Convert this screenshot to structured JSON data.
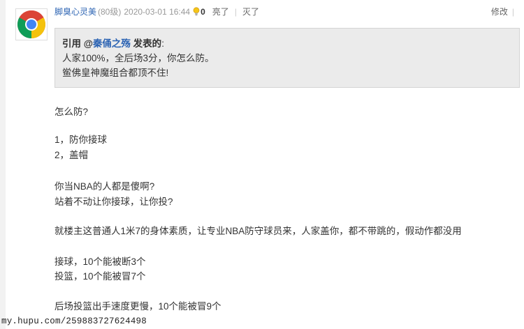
{
  "post": {
    "username": "脚臭心灵美",
    "level": "(80级)",
    "timestamp": "2020-03-01 16:44",
    "light_count": "0",
    "light_action": "亮了",
    "dark_action": "灭了",
    "edit_action": "修改"
  },
  "quote": {
    "prefix": "引用 @",
    "quoted_user": "秦俑之殇",
    "suffix": " 发表的",
    "colon": ":",
    "lines": [
      "人家100%，全后场3分，你怎么防。",
      "鲎佛皇神魔组合都顶不住!"
    ]
  },
  "body": {
    "lines": [
      "怎么防?",
      "1，防你接球",
      "2，盖帽",
      "你当NBA的人都是傻啊?",
      "站着不动让你接球，让你投?",
      "就楼主这普通人1米7的身体素质，让专业NBA防守球员来，人家盖你，都不带跳的，假动作都没用",
      "接球，10个能被断3个",
      "投篮，10个能被冒7个",
      "后场投篮出手速度更慢，10个能被冒9个"
    ]
  },
  "watermark": {
    "text": "my.hupu.com/259883727624498"
  },
  "colors": {
    "username": "#2d64b3",
    "quote_background": "#ebebeb",
    "text": "#333333",
    "muted": "#999999"
  },
  "icons": {
    "avatar": "chrome-logo",
    "light": "lightbulb-icon"
  }
}
